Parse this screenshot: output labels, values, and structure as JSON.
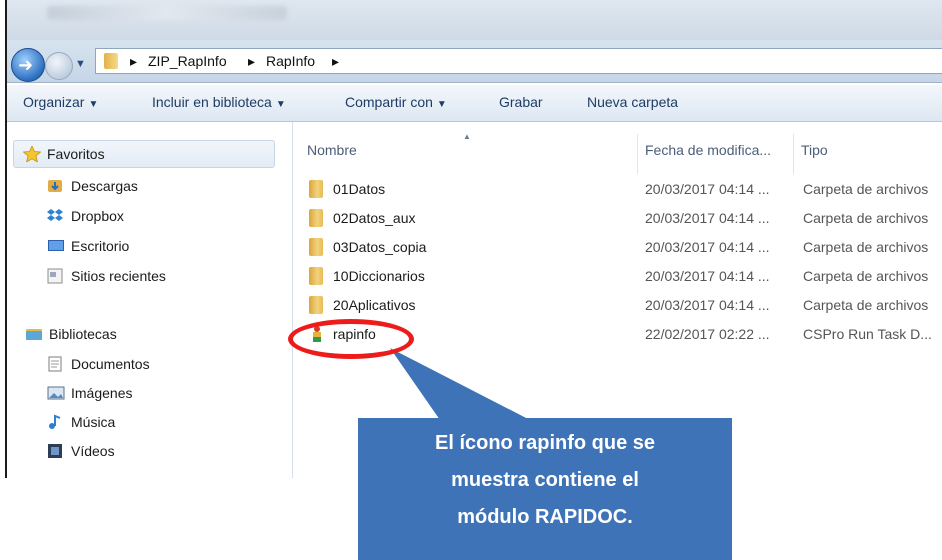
{
  "address": {
    "crumbs": [
      "ZIP_RapInfo",
      "RapInfo"
    ],
    "separator": "▸"
  },
  "toolbar": {
    "organize": "Organizar",
    "include_library": "Incluir en biblioteca",
    "share": "Compartir con",
    "burn": "Grabar",
    "new_folder": "Nueva carpeta"
  },
  "nav": {
    "favorites": {
      "label": "Favoritos",
      "items": [
        "Descargas",
        "Dropbox",
        "Escritorio",
        "Sitios recientes"
      ]
    },
    "libraries": {
      "label": "Bibliotecas",
      "items": [
        "Documentos",
        "Imágenes",
        "Música",
        "Vídeos"
      ]
    }
  },
  "columns": {
    "name": "Nombre",
    "date": "Fecha de modifica...",
    "type": "Tipo"
  },
  "files": [
    {
      "name": "01Datos",
      "date": "20/03/2017 04:14 ...",
      "type": "Carpeta de archivos"
    },
    {
      "name": "02Datos_aux",
      "date": "20/03/2017 04:14 ...",
      "type": "Carpeta de archivos"
    },
    {
      "name": "03Datos_copia",
      "date": "20/03/2017 04:14 ...",
      "type": "Carpeta de archivos"
    },
    {
      "name": "10Diccionarios",
      "date": "20/03/2017 04:14 ...",
      "type": "Carpeta de archivos"
    },
    {
      "name": "20Aplicativos",
      "date": "20/03/2017 04:14 ...",
      "type": "Carpeta de archivos"
    },
    {
      "name": "rapinfo",
      "date": "22/02/2017 02:22 ...",
      "type": "CSPro Run Task D..."
    }
  ],
  "callout": {
    "lines": [
      "El ícono rapinfo que se",
      "muestra contiene el",
      "módulo RAPIDOC."
    ],
    "color": "#3f73b8",
    "highlight_color": "#ee1b1b"
  },
  "icons": [
    "back-arrow-icon",
    "forward-arrow-icon",
    "folder-icon",
    "star-icon",
    "download-icon",
    "dropbox-icon",
    "desktop-icon",
    "recent-places-icon",
    "library-icon",
    "document-icon",
    "image-icon",
    "music-icon",
    "video-icon",
    "cspro-task-icon"
  ]
}
